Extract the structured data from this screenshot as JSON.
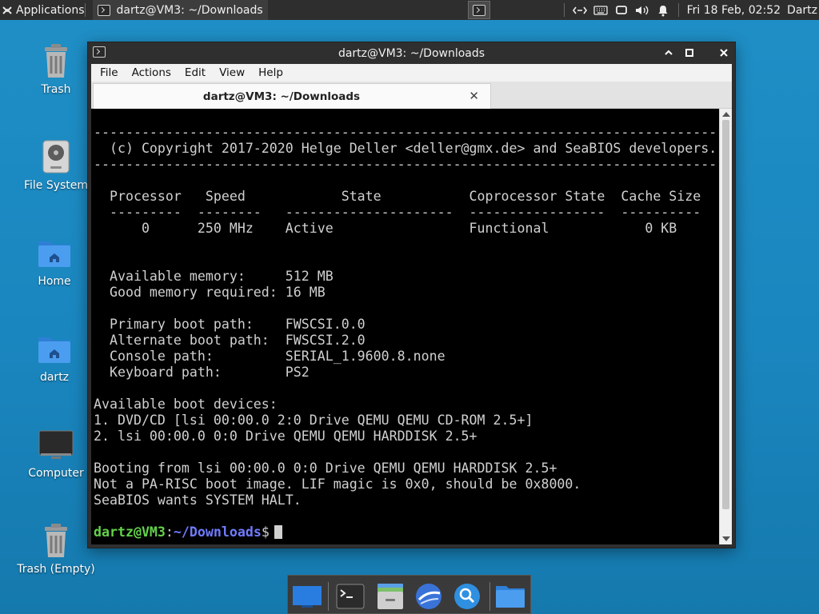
{
  "top_panel": {
    "applications_label": "Applications",
    "task_label": "dartz@VM3: ~/Downloads",
    "clock": "Fri 18 Feb, 02:52",
    "user": "Dartz"
  },
  "desktop_icons": [
    {
      "label": "Trash"
    },
    {
      "label": "File System"
    },
    {
      "label": "Home"
    },
    {
      "label": "dartz"
    },
    {
      "label": "Computer"
    },
    {
      "label": "Trash (Empty)"
    }
  ],
  "window": {
    "title": "dartz@VM3: ~/Downloads",
    "menu": [
      "File",
      "Actions",
      "Edit",
      "View",
      "Help"
    ],
    "tab_title": "dartz@VM3: ~/Downloads",
    "tab_close": "✕",
    "terminal_output": "------------------------------------------------------------------------------\n  (c) Copyright 2017-2020 Helge Deller <deller@gmx.de> and SeaBIOS developers.\n------------------------------------------------------------------------------\n\n  Processor   Speed            State           Coprocessor State  Cache Size\n  ---------  --------   ---------------------  -----------------  ----------\n      0      250 MHz    Active                 Functional            0 KB\n\n\n  Available memory:     512 MB\n  Good memory required: 16 MB\n\n  Primary boot path:    FWSCSI.0.0\n  Alternate boot path:  FWSCSI.2.0\n  Console path:         SERIAL_1.9600.8.none\n  Keyboard path:        PS2\n\nAvailable boot devices:\n1. DVD/CD [lsi 00:00.0 2:0 Drive QEMU QEMU CD-ROM 2.5+]\n2. lsi 00:00.0 0:0 Drive QEMU QEMU HARDDISK 2.5+\n\nBooting from lsi 00:00.0 0:0 Drive QEMU QEMU HARDDISK 2.5+\nNot a PA-RISC boot image. LIF magic is 0x0, should be 0x8000.\nSeaBIOS wants SYSTEM HALT.",
    "prompt": {
      "user_host": "dartz@VM3",
      "colon": ":",
      "path": "~/Downloads",
      "dollar": "$"
    }
  },
  "dock": {
    "items": [
      "show-desktop",
      "terminal",
      "file-manager",
      "web-browser",
      "app-finder",
      "files-folder"
    ]
  },
  "colors": {
    "desktop": "#1a86bf",
    "panel": "#2e2e2e",
    "terminal_bg": "#000000",
    "prompt_user": "#63d24a",
    "prompt_path": "#6f7cff"
  }
}
